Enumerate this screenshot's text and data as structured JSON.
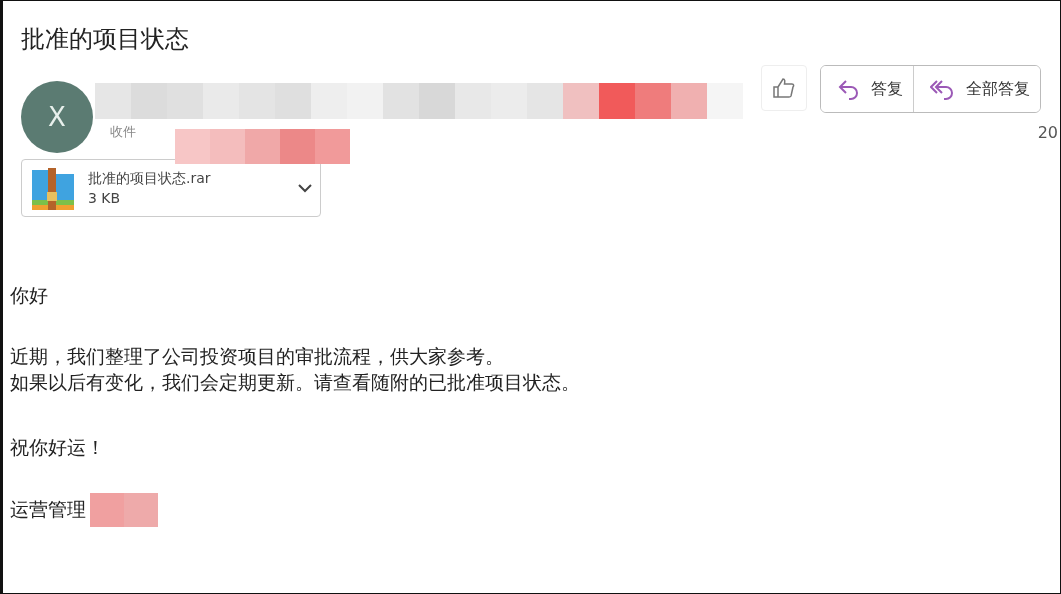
{
  "subject": "批准的项目状态",
  "sender": {
    "initial": "X",
    "recipient_label": "收件"
  },
  "actions": [
    {
      "kind": "like"
    },
    {
      "kind": "reply",
      "label": "答复"
    },
    {
      "kind": "reply_all",
      "label": "全部答复"
    }
  ],
  "date": "20",
  "attachment": {
    "name": "批准的项目状态.rar",
    "size": "3 KB"
  },
  "body": {
    "greeting": "你好",
    "paragraph": [
      "近期，我们整理了公司投资项目的审批流程，供大家参考。",
      "如果以后有变化，我们会定期更新。请查看随附的已批准项目状态。"
    ],
    "closing": "祝你好运！",
    "signature": "运营管理"
  }
}
